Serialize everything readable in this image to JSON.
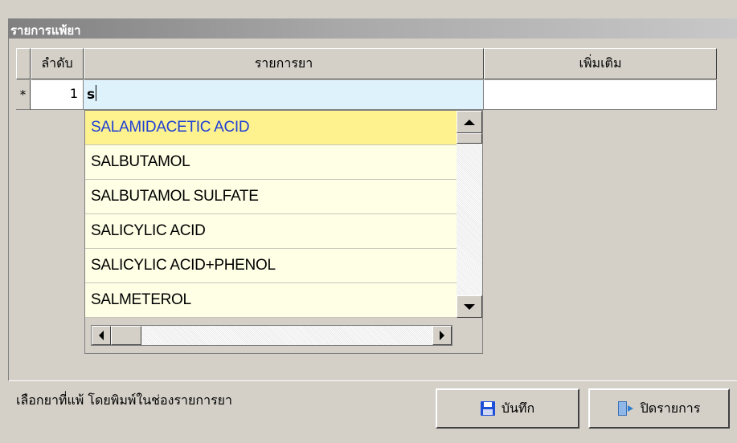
{
  "window": {
    "title": "รายการแพ้ยา"
  },
  "grid": {
    "columns": [
      "ลำดับ",
      "รายการยา",
      "เพิ่มเติม"
    ],
    "new_row_marker": "*",
    "row": {
      "seq": "1",
      "drug_input": "s",
      "extra": ""
    }
  },
  "dropdown": {
    "items": [
      "SALAMIDACETIC ACID",
      "SALBUTAMOL",
      "SALBUTAMOL SULFATE",
      "SALICYLIC ACID",
      "SALICYLIC ACID+PHENOL",
      "SALMETEROL"
    ],
    "selected_index": 0
  },
  "footer": {
    "hint": "เลือกยาที่แพ้ โดยพิมพ์ในช่องรายการยา",
    "save_label": "บันทึก",
    "close_label": "ปิดรายการ"
  },
  "colors": {
    "selected_text": "#1f3fd6",
    "selected_bg": "#fdf28e",
    "list_bg": "#ffffe6",
    "input_bg": "#ddf2fb"
  },
  "icons": {
    "save": "floppy-disk-icon",
    "close": "door-exit-icon"
  }
}
